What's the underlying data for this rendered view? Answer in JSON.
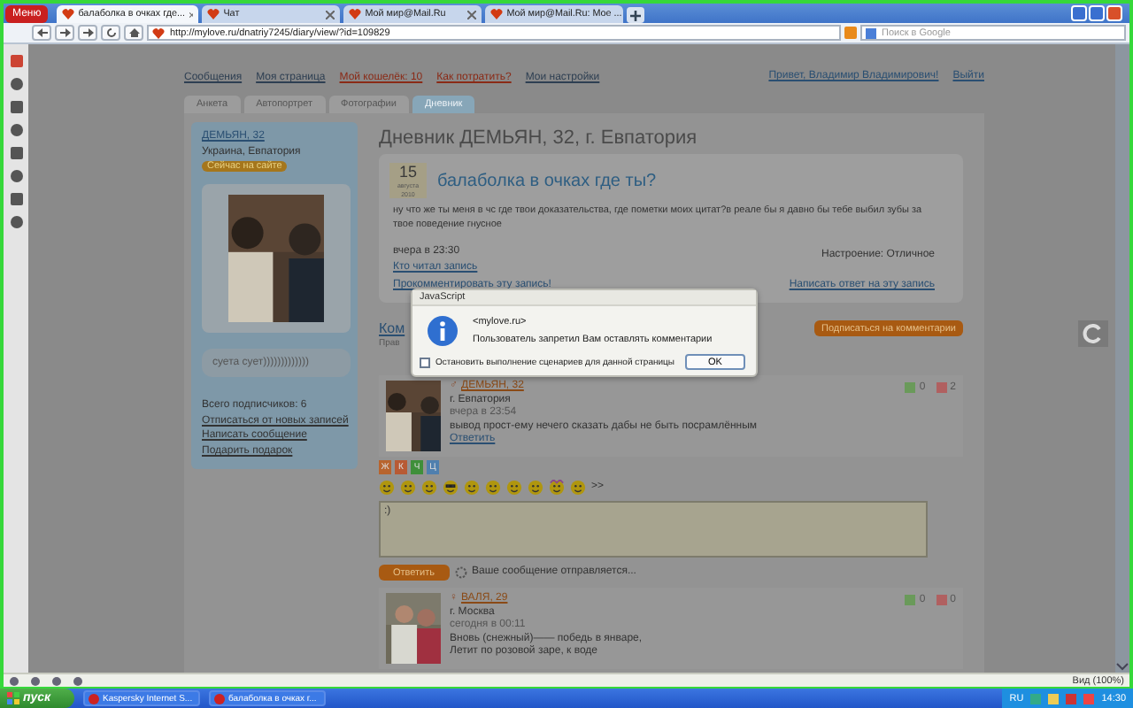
{
  "browser": {
    "menu_label": "Меню",
    "tabs": [
      {
        "label": "балаболка в очках где...",
        "selected": true
      },
      {
        "label": "Чат",
        "selected": false
      },
      {
        "label": "Мой мир@Mail.Ru",
        "selected": false
      },
      {
        "label": "Мой мир@Mail.Ru: Мое ...",
        "selected": false
      }
    ],
    "url": "http://mylove.ru/dnatriy7245/diary/view/?id=109829",
    "search_placeholder": "Поиск в Google"
  },
  "site_nav": {
    "items": [
      {
        "label": "Сообщения",
        "accent": false
      },
      {
        "label": "Моя страница",
        "accent": false
      },
      {
        "label": "Мой кошелёк: 10",
        "accent": true
      },
      {
        "label": "Как потратить?",
        "accent": true
      },
      {
        "label": "Мои настройки",
        "accent": false
      }
    ],
    "greeting": "Привет, Владимир Владимирович!",
    "logout": "Выйти"
  },
  "profile_tabs": [
    {
      "label": "Анкета",
      "selected": false
    },
    {
      "label": "Автопортрет",
      "selected": false
    },
    {
      "label": "Фотографии",
      "selected": false
    },
    {
      "label": "Дневник",
      "selected": true
    }
  ],
  "profile": {
    "name": "ДЕМЬЯН, 32",
    "location": "Украина, Евпатория",
    "online_badge": "Сейчас на сайте",
    "status": "суета сует)))))))))))))",
    "subscribers": "Всего подписчиков: 6",
    "links": [
      "Отписаться от новых записей",
      "Написать сообщение",
      "Подарить подарок"
    ]
  },
  "diary": {
    "title": "Дневник ДЕМЬЯН, 32, г. Евпатория",
    "entry": {
      "day": "15",
      "month": "августа",
      "year": "2010",
      "title": "балаболка в очках где ты?",
      "body": "ну что же ты меня в чс где твои доказательства, где пометки моих цитат?в реале бы я давно бы тебе выбил зубы за твое поведение гнусное",
      "time": "вчера в 23:30",
      "links": [
        "Кто читал запись",
        "Прокомментировать эту запись!"
      ],
      "mood": "Настроение: Отличное",
      "reply_link": "Написать ответ на эту запись"
    },
    "comments_title": "Ком",
    "comments_note": "Прав",
    "subscribe_button": "Подписаться на комментарии",
    "comments": [
      {
        "sign": "♂",
        "name": "ДЕМЬЯН, 32",
        "location": "г. Евпатория",
        "time": "вчера в 23:54",
        "lines": [
          "вывод прост-ему нечего сказать дабы не быть посрамлённым"
        ],
        "reply": "Ответить",
        "up": "0",
        "down": "2"
      },
      {
        "sign": "♀",
        "name": "ВАЛЯ, 29",
        "location": "г. Москва",
        "time": "сегодня в 00:11",
        "lines": [
          "Вновь (снежный)—— победь в январе,",
          "Летит по розовой заре, к воде"
        ],
        "up": "0",
        "down": "0"
      }
    ],
    "editor": {
      "format_buttons": [
        {
          "label": "Ж",
          "color": "#b8642e"
        },
        {
          "label": "К",
          "color": "#b85a34"
        },
        {
          "label": "Ч",
          "color": "#3f8f3a"
        },
        {
          "label": "Ц",
          "color": "#4f7fae"
        }
      ],
      "more": ">>",
      "value": ":)",
      "submit": "Ответить",
      "sending": "Ваше сообщение отправляется..."
    }
  },
  "dialog": {
    "title": "JavaScript",
    "source": "<mylove.ru>",
    "message": "Пользователь запретил Вам оставлять комментарии",
    "checkbox": {
      "label": "Остановить выполнение сценариев для данной страницы",
      "checked": false
    },
    "ok": "OK"
  },
  "status_bar": {
    "zoom": "Вид (100%)"
  },
  "taskbar": {
    "start": "пуск",
    "items": [
      "Kaspersky Internet S...",
      "балаболка в очках г..."
    ],
    "lang": "RU",
    "clock": "14:30"
  }
}
